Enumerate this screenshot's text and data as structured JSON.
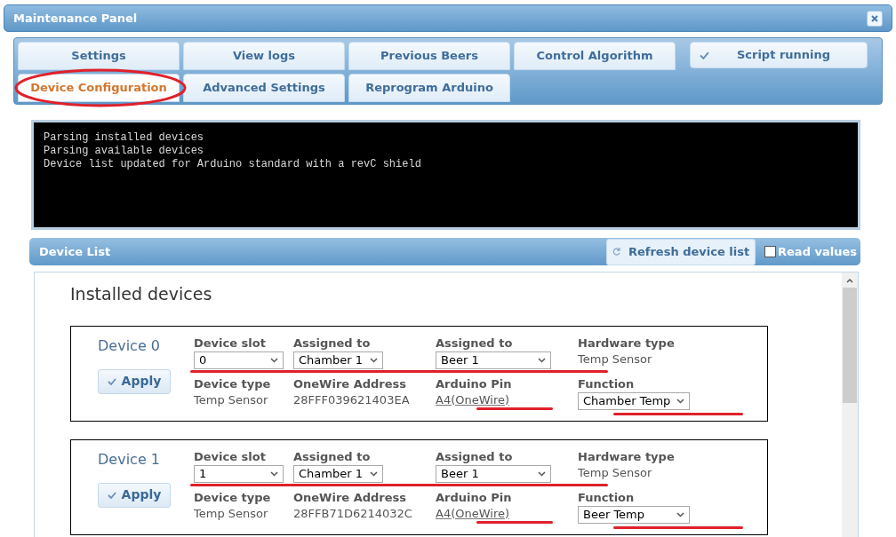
{
  "window": {
    "title": "Maintenance Panel"
  },
  "tabs": [
    {
      "label": "Settings",
      "selected": false
    },
    {
      "label": "View logs",
      "selected": false
    },
    {
      "label": "Previous Beers",
      "selected": false
    },
    {
      "label": "Control Algorithm",
      "selected": false
    },
    {
      "label": "Device Configuration",
      "selected": true
    },
    {
      "label": "Advanced Settings",
      "selected": false
    },
    {
      "label": "Reprogram Arduino",
      "selected": false
    }
  ],
  "script_status": {
    "label": "Script running"
  },
  "console": [
    "Parsing installed devices",
    "Parsing available devices",
    "Device list updated for Arduino standard with a revC shield"
  ],
  "device_list": {
    "title": "Device List",
    "refresh_button": "Refresh device list",
    "read_values": {
      "label": "Read values",
      "checked": false
    },
    "heading": "Installed devices",
    "devices": [
      {
        "title": "Device 0",
        "apply": "Apply",
        "fields": [
          {
            "label": "Device slot",
            "kind": "select",
            "value": "0"
          },
          {
            "label": "Assigned to",
            "kind": "select",
            "value": "Chamber 1"
          },
          {
            "label": "Assigned to",
            "kind": "select",
            "value": "Beer 1"
          },
          {
            "label": "Hardware type",
            "kind": "text",
            "value": "Temp Sensor"
          },
          {
            "label": "Device type",
            "kind": "text",
            "value": "Temp Sensor"
          },
          {
            "label": "OneWire Address",
            "kind": "text",
            "value": "28FFF039621403EA"
          },
          {
            "label": "Arduino Pin",
            "kind": "link",
            "value": "A4(OneWire)"
          },
          {
            "label": "Function",
            "kind": "select",
            "value": "Chamber Temp"
          }
        ]
      },
      {
        "title": "Device 1",
        "apply": "Apply",
        "fields": [
          {
            "label": "Device slot",
            "kind": "select",
            "value": "1"
          },
          {
            "label": "Assigned to",
            "kind": "select",
            "value": "Chamber 1"
          },
          {
            "label": "Assigned to",
            "kind": "select",
            "value": "Beer 1"
          },
          {
            "label": "Hardware type",
            "kind": "text",
            "value": "Temp Sensor"
          },
          {
            "label": "Device type",
            "kind": "text",
            "value": "Temp Sensor"
          },
          {
            "label": "OneWire Address",
            "kind": "text",
            "value": "28FFB71D6214032C"
          },
          {
            "label": "Arduino Pin",
            "kind": "link",
            "value": "A4(OneWire)"
          },
          {
            "label": "Function",
            "kind": "select",
            "value": "Beer Temp"
          }
        ]
      }
    ]
  }
}
